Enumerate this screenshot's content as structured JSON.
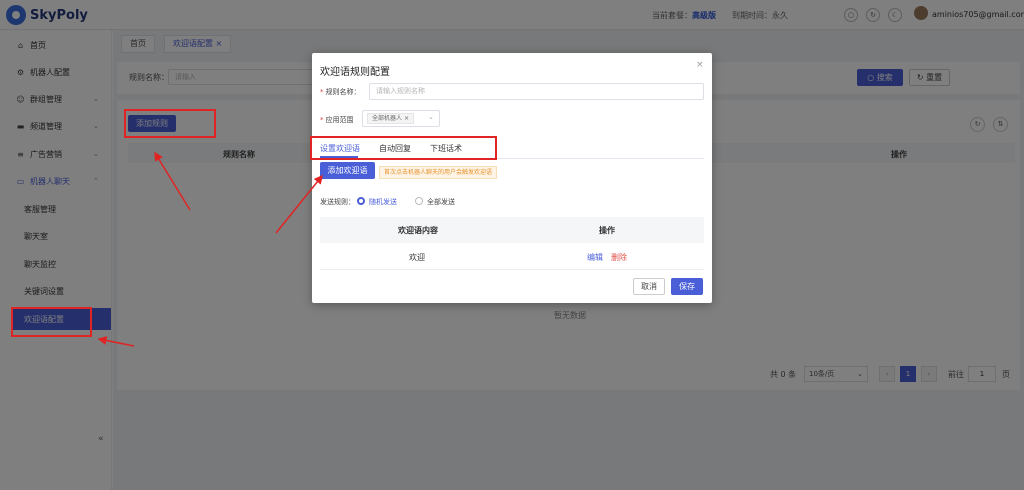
{
  "app": {
    "brand": "SkyPoly",
    "plan_label": "当前套餐：",
    "plan_value": "高级版",
    "expire_label": "到期时间：",
    "expire_value": "永久",
    "user_email": "aminios705@gmail.com"
  },
  "sidebar": {
    "items": [
      {
        "label": "首页",
        "icon": "home-icon"
      },
      {
        "label": "机器人配置",
        "icon": "robot-icon"
      },
      {
        "label": "群组管理",
        "icon": "group-icon"
      },
      {
        "label": "频道管理",
        "icon": "channel-icon"
      },
      {
        "label": "广告营销",
        "icon": "ad-icon"
      },
      {
        "label": "机器人聊天",
        "icon": "chat-icon"
      }
    ],
    "sub_items": [
      {
        "label": "客服管理"
      },
      {
        "label": "聊天室"
      },
      {
        "label": "聊天监控"
      },
      {
        "label": "关键词设置"
      },
      {
        "label": "欢迎语配置"
      }
    ],
    "collapse_glyph": "«"
  },
  "tabs": [
    {
      "label": "首页"
    },
    {
      "label": "欢迎语配置"
    }
  ],
  "search": {
    "label": "规则名称：",
    "placeholder": "请输入",
    "search_btn": "搜索",
    "reset_btn": "重置"
  },
  "table": {
    "add_btn": "添加规则",
    "columns": [
      "规则名称",
      "操作"
    ],
    "empty_text": "暂无数据"
  },
  "pagination": {
    "total": "共 0 条",
    "page_size": "10条/页",
    "current_page": "1",
    "goto_label": "前往",
    "goto_value": "1",
    "page_unit": "页"
  },
  "modal": {
    "title": "欢迎语规则配置",
    "close": "×",
    "name_label": "规则名称：",
    "name_placeholder": "请输入规则名称",
    "scope_label": "应用范围",
    "scope_tag": "全部机器人",
    "tabs": [
      "设置欢迎语",
      "自动回复",
      "下班话术"
    ],
    "add_btn": "添加欢迎语",
    "hint": "首次点击机器人聊天的用户会触发欢迎语",
    "send_rule_label": "发送规则：",
    "send_options": [
      "随机发送",
      "全部发送"
    ],
    "inner_columns": [
      "欢迎语内容",
      "操作"
    ],
    "rows": [
      {
        "content": "欢迎",
        "edit": "编辑",
        "delete": "删除"
      }
    ],
    "cancel_btn": "取消",
    "save_btn": "保存"
  },
  "colors": {
    "primary": "#4a5ed8",
    "annotation_red": "#e02424",
    "danger": "#e0504a",
    "hint_text": "#e8932c"
  }
}
